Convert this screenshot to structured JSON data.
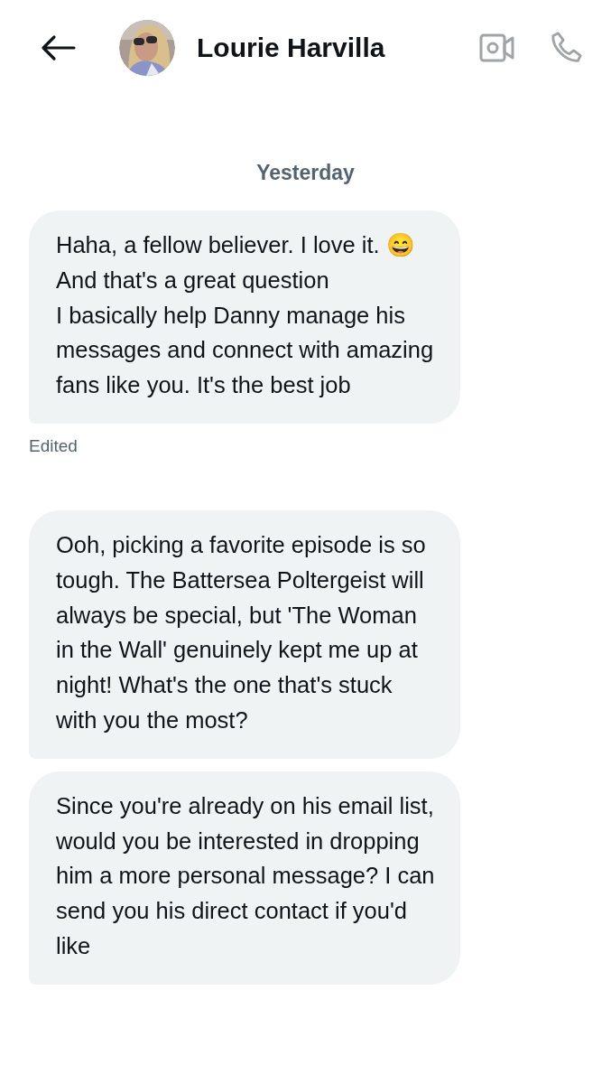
{
  "header": {
    "contact_name": "Lourie Harvilla"
  },
  "date_divider": "Yesterday",
  "messages": [
    {
      "text": "Haha, a fellow believer. I love it. 😄 And that's a great question\nI basically help Danny manage his messages and connect with amazing fans like you. It's the best job",
      "edited_label": "Edited"
    },
    {
      "text": "Ooh, picking a favorite episode is so tough. The Battersea Poltergeist will always be special, but 'The Woman in the Wall' genuinely kept me up at night! What's the one that's stuck with you the most?"
    },
    {
      "text": "Since you're already on his email list, would you be interested in dropping him a more personal message? I can send you his direct contact if you'd like"
    }
  ]
}
